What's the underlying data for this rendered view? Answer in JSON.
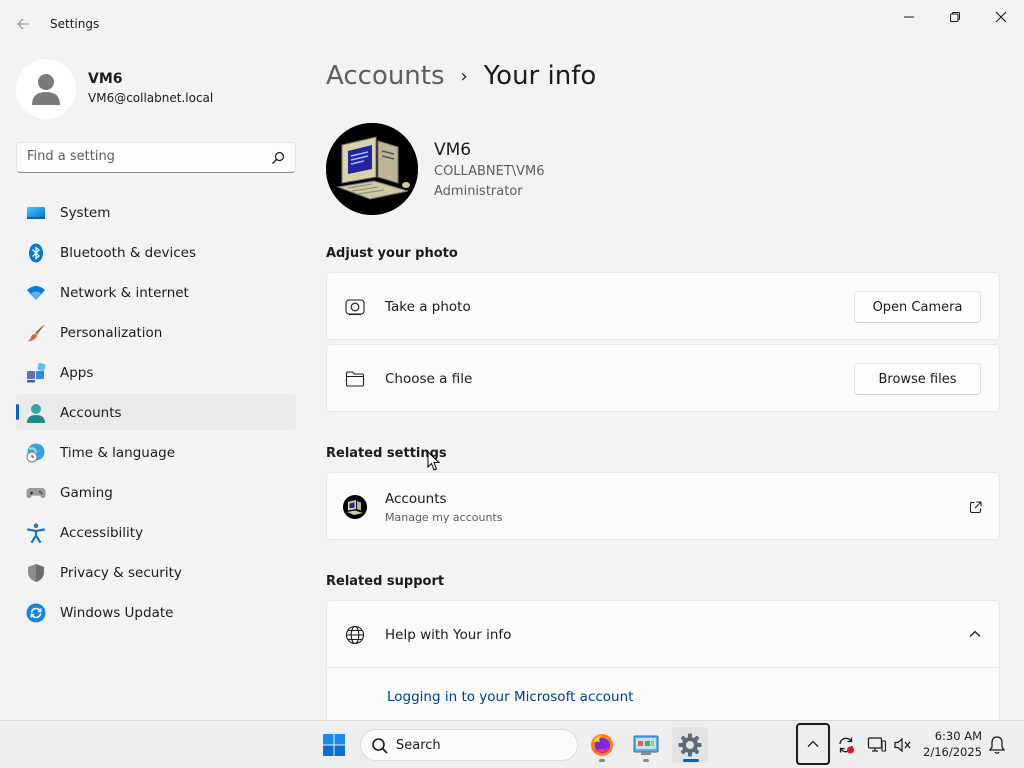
{
  "window": {
    "title": "Settings"
  },
  "sidebar": {
    "profile": {
      "name": "VM6",
      "email": "VM6@collabnet.local"
    },
    "search": {
      "placeholder": "Find a setting"
    },
    "items": [
      {
        "label": "System",
        "icon": "monitor-icon",
        "active": false
      },
      {
        "label": "Bluetooth & devices",
        "icon": "bluetooth-icon",
        "active": false
      },
      {
        "label": "Network & internet",
        "icon": "wifi-icon",
        "active": false
      },
      {
        "label": "Personalization",
        "icon": "paintbrush-icon",
        "active": false
      },
      {
        "label": "Apps",
        "icon": "apps-icon",
        "active": false
      },
      {
        "label": "Accounts",
        "icon": "person-icon",
        "active": true
      },
      {
        "label": "Time & language",
        "icon": "globe-clock-icon",
        "active": false
      },
      {
        "label": "Gaming",
        "icon": "gamepad-icon",
        "active": false
      },
      {
        "label": "Accessibility",
        "icon": "accessibility-icon",
        "active": false
      },
      {
        "label": "Privacy & security",
        "icon": "shield-icon",
        "active": false
      },
      {
        "label": "Windows Update",
        "icon": "update-icon",
        "active": false
      }
    ]
  },
  "main": {
    "breadcrumb": {
      "parent": "Accounts",
      "separator": "›",
      "current": "Your info"
    },
    "user": {
      "name": "VM6",
      "domain": "COLLABNET\\VM6",
      "role": "Administrator"
    },
    "adjust_photo": {
      "title": "Adjust your photo",
      "take_photo": {
        "label": "Take a photo",
        "button": "Open Camera"
      },
      "choose_file": {
        "label": "Choose a file",
        "button": "Browse files"
      }
    },
    "related_settings": {
      "title": "Related settings",
      "accounts": {
        "label": "Accounts",
        "sublabel": "Manage my accounts"
      }
    },
    "related_support": {
      "title": "Related support",
      "help": {
        "label": "Help with Your info",
        "link": "Logging in to your Microsoft account"
      }
    }
  },
  "taskbar": {
    "search_label": "Search",
    "time": "6:30 AM",
    "date": "2/16/2025"
  },
  "colors": {
    "accent": "#0067c0",
    "link": "#003e92",
    "background": "#f3f3f3",
    "card": "#fbfbfb"
  }
}
